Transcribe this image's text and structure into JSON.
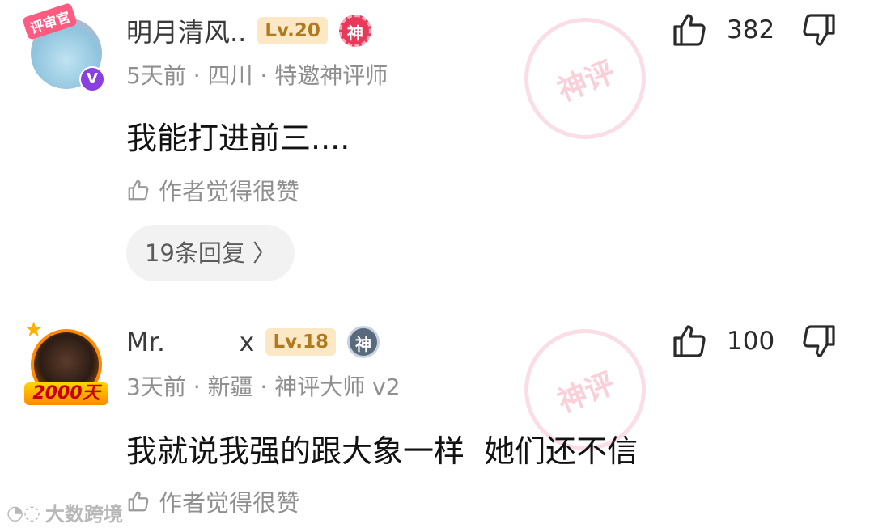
{
  "comments": [
    {
      "avatar_tag": "评审官",
      "avatar_badge": "V",
      "username": "明月清风..",
      "level": "Lv.20",
      "god_badge": "神",
      "meta": "5天前 · 四川 · 特邀神评师",
      "text": "我能打进前三....",
      "author_like": "作者觉得很赞",
      "likes": "382",
      "watermark": "神评",
      "replies": "19条回复 〉"
    },
    {
      "avatar_ribbon": "2000天",
      "username": "Mr.         x",
      "level": "Lv.18",
      "god_badge": "神",
      "meta": "3天前 · 新疆 · 神评大师 v2",
      "text": "我就说我强的跟大象一样  她们还不信",
      "author_like": "作者觉得很赞",
      "likes": "100",
      "watermark": "神评"
    }
  ],
  "site_watermark": "大数跨境",
  "icons": [
    "thumb-up-icon",
    "thumb-down-icon"
  ],
  "colors": {
    "level_bg": "#fde8c6",
    "level_text": "#b07a1f",
    "god_red": "#e8395b",
    "verified_purple": "#8a3fe0"
  }
}
